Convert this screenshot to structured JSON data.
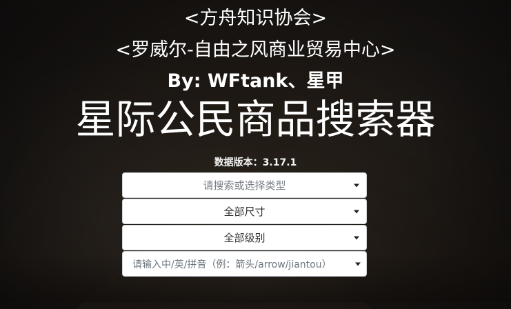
{
  "header": {
    "org_name": "<方舟知识协会>",
    "center_name": "<罗威尔-自由之风商业贸易中心>",
    "authors": "By: WFtank、星甲",
    "title": "星际公民商品搜索器",
    "version_label": "数据版本：",
    "version_value": "3.17.1"
  },
  "controls": {
    "type_select": {
      "placeholder": "请搜索或选择类型"
    },
    "size_select": {
      "value": "全部尺寸"
    },
    "grade_select": {
      "value": "全部级别"
    },
    "search_input": {
      "placeholder": "请输入中/英/拼音（例：箭头/arrow/jiantou）"
    }
  },
  "colors": {
    "background": "#1b1713",
    "text_primary": "#ffffff",
    "control_bg": "#ffffff",
    "control_border": "#cfd4d9",
    "control_text": "#495057"
  }
}
